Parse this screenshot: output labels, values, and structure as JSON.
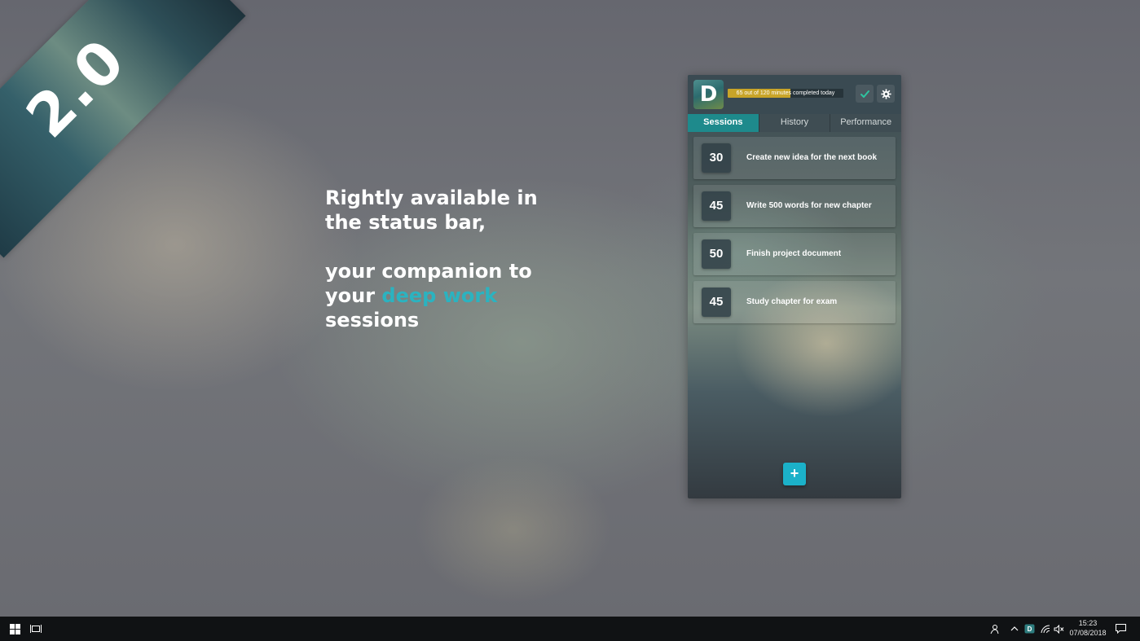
{
  "ribbon": {
    "label": "2.0"
  },
  "tagline": {
    "line1": "Rightly available in",
    "line2": "the status bar,",
    "line3": "your companion to",
    "line4_prefix": "your ",
    "line4_accent": "deep work",
    "line5": "sessions",
    "accent_color": "#2bb3c0"
  },
  "app": {
    "logo_letter": "D",
    "progress": {
      "text": "65 out of 120 minutes completed today",
      "completed_minutes": 65,
      "total_minutes": 120,
      "fill_color": "#c8a428"
    },
    "header_buttons": {
      "check_icon": "check-icon",
      "settings_icon": "gear-icon"
    },
    "tabs": [
      {
        "label": "Sessions",
        "active": true
      },
      {
        "label": "History",
        "active": false
      },
      {
        "label": "Performance",
        "active": false
      }
    ],
    "sessions": [
      {
        "minutes": "30",
        "title": "Create new idea for the next book"
      },
      {
        "minutes": "45",
        "title": "Write 500 words for new chapter"
      },
      {
        "minutes": "50",
        "title": "Finish project document"
      },
      {
        "minutes": "45",
        "title": "Study chapter for exam"
      }
    ],
    "add_button_label": "+",
    "accent_color": "#1e8a8c"
  },
  "taskbar": {
    "start_icon": "windows-icon",
    "task_view_icon": "task-view-icon",
    "tray_icons": [
      "people-icon",
      "chevron-up-icon",
      "app-tray-icon",
      "wifi-icon",
      "volume-muted-icon"
    ],
    "time": "15:23",
    "date": "07/08/2018",
    "notification_icon": "notification-icon"
  }
}
